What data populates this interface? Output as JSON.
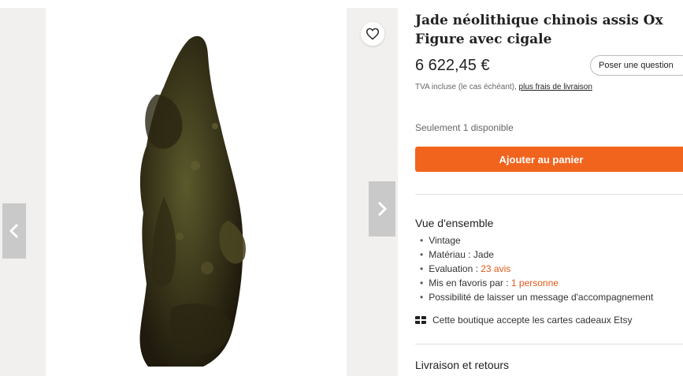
{
  "product": {
    "title": "Jade néolithique chinois assis Ox Figure avec cigale",
    "price": "6 622,45 €",
    "ask_label": "Poser une question",
    "tax_text": "TVA incluse (le cas échéant), ",
    "tax_link": "plus frais de livraison",
    "stock": "Seulement 1 disponible",
    "cart_label": "Ajouter au panier"
  },
  "overview": {
    "title": "Vue d'ensemble",
    "items": [
      {
        "text": "Vintage"
      },
      {
        "text": "Matériau : Jade"
      },
      {
        "text": "Evaluation : ",
        "link": "23 avis"
      },
      {
        "text": "Mis en favoris par : ",
        "link": "1 personne"
      },
      {
        "text": "Possibilité de laisser un message d'accompagnement"
      }
    ]
  },
  "giftcard": {
    "icon": "gift-card-icon",
    "text": "Cette boutique accepte les cartes cadeaux Etsy"
  },
  "shipping": {
    "title": "Livraison et retours"
  },
  "colors": {
    "accent": "#f1641e",
    "link": "#e05a1c"
  }
}
